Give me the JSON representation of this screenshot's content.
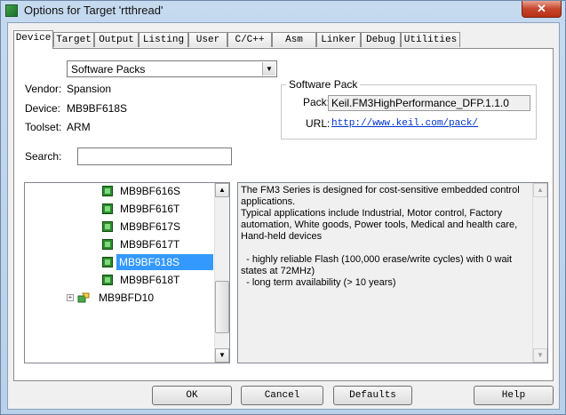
{
  "window": {
    "title": "Options for Target 'rtthread'",
    "close_glyph": "✕"
  },
  "tabs": [
    {
      "label": "Device"
    },
    {
      "label": "Target"
    },
    {
      "label": "Output"
    },
    {
      "label": "Listing"
    },
    {
      "label": "User"
    },
    {
      "label": "C/C++"
    },
    {
      "label": "Asm"
    },
    {
      "label": "Linker"
    },
    {
      "label": "Debug"
    },
    {
      "label": "Utilities"
    }
  ],
  "device": {
    "database_select": "Software Packs",
    "vendor_label": "Vendor:",
    "vendor_value": "Spansion",
    "device_label": "Device:",
    "device_value": "MB9BF618S",
    "toolset_label": "Toolset:",
    "toolset_value": "ARM",
    "search_label": "Search:",
    "search_value": ""
  },
  "software_pack": {
    "title": "Software Pack",
    "pack_label": "Pack:",
    "pack_value": "Keil.FM3HighPerformance_DFP.1.1.0",
    "url_label": "URL:",
    "url_value": "http://www.keil.com/pack/"
  },
  "tree": {
    "items": [
      {
        "label": "MB9BF616S"
      },
      {
        "label": "MB9BF616T"
      },
      {
        "label": "MB9BF617S"
      },
      {
        "label": "MB9BF617T"
      },
      {
        "label": "MB9BF618S"
      },
      {
        "label": "MB9BF618T"
      },
      {
        "label": "MB9BFD10"
      }
    ],
    "selected_index": 4
  },
  "description": "The FM3 Series is designed for cost-sensitive embedded control applications.\nTypical applications include Industrial, Motor control, Factory automation, White goods, Power tools, Medical and health care, Hand-held devices\n\n  - highly reliable Flash (100,000 erase/write cycles) with 0 wait states at 72MHz)\n  - long term availability (> 10 years)",
  "buttons": {
    "ok": "OK",
    "cancel": "Cancel",
    "defaults": "Defaults",
    "help": "Help"
  },
  "icons": {
    "chip": "chip-icon",
    "folder": "device-family-icon",
    "expand": "plus-expander-icon"
  },
  "colors": {
    "selection": "#3399ff",
    "link": "#0033cc",
    "chip": "#2e8b2e"
  }
}
